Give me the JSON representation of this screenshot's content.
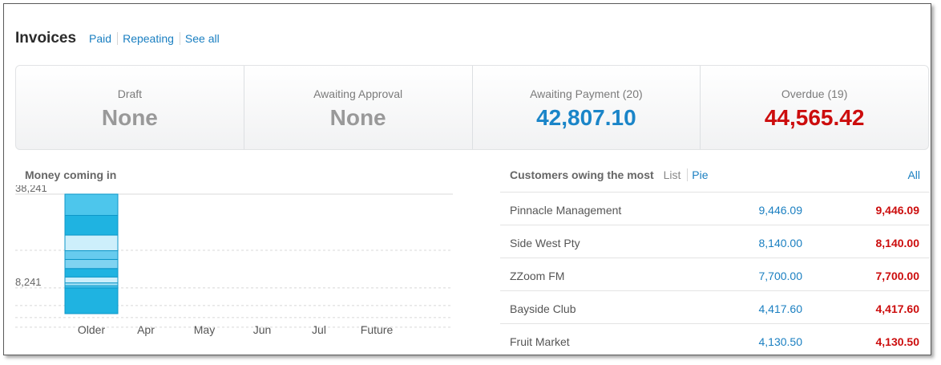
{
  "header": {
    "title": "Invoices",
    "links": [
      "Paid",
      "Repeating",
      "See all"
    ]
  },
  "stats": [
    {
      "label": "Draft",
      "value": "None"
    },
    {
      "label": "Awaiting Approval",
      "value": "None"
    },
    {
      "label": "Awaiting Payment (20)",
      "value": "42,807.10"
    },
    {
      "label": "Overdue (19)",
      "value": "44,565.42"
    }
  ],
  "chart_data": {
    "type": "bar",
    "title": "Money coming in",
    "categories": [
      "Older",
      "Apr",
      "May",
      "Jun",
      "Jul",
      "Future"
    ],
    "ytick_labels": [
      "38,241",
      "8,241"
    ],
    "ytick_values": [
      38241,
      8241
    ],
    "ylim": [
      0,
      38241
    ],
    "stacked": true,
    "stacks": [
      [
        8241,
        700,
        900,
        1900,
        2700,
        2900,
        2800,
        5000,
        6300,
        6800
      ],
      [],
      [],
      [],
      [],
      []
    ],
    "segment_colors": [
      "#1fb3e1",
      "#4dc6ec",
      "#a6e2f6",
      "#cdeffb",
      "#1fb3e1",
      "#7fd3f1",
      "#67cbee",
      "#cdeffb",
      "#1fb3e1",
      "#4dc6ec"
    ],
    "grid": true
  },
  "customers": {
    "title": "Customers owing the most",
    "views": [
      "List",
      "Pie"
    ],
    "all_label": "All",
    "rows": [
      {
        "name": "Pinnacle Management",
        "amount": "9,446.09",
        "overdue": "9,446.09"
      },
      {
        "name": "Side West Pty",
        "amount": "8,140.00",
        "overdue": "8,140.00"
      },
      {
        "name": "ZZoom FM",
        "amount": "7,700.00",
        "overdue": "7,700.00"
      },
      {
        "name": "Bayside Club",
        "amount": "4,417.60",
        "overdue": "4,417.60"
      },
      {
        "name": "Fruit Market",
        "amount": "4,130.50",
        "overdue": "4,130.50"
      }
    ]
  }
}
